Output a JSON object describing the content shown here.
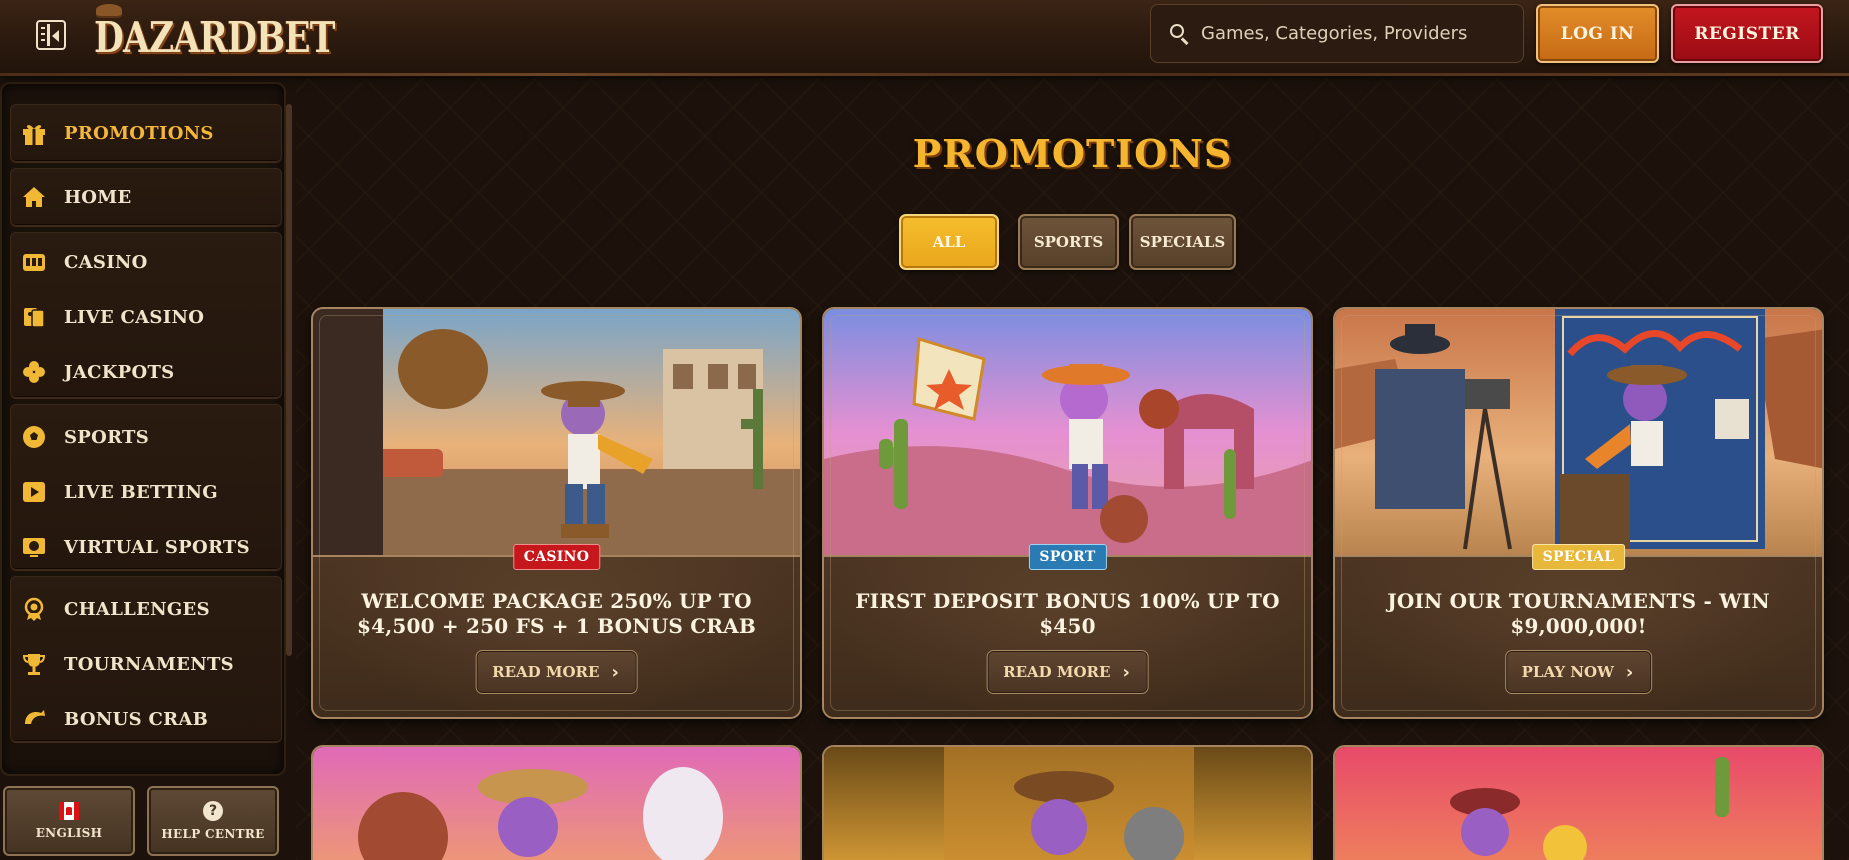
{
  "brand": {
    "logo_text": "DAZARDBET"
  },
  "header": {
    "search_placeholder": "Games, Categories, Providers",
    "login_label": "LOG IN",
    "register_label": "REGISTER"
  },
  "sidebar": {
    "items": [
      {
        "label": "PROMOTIONS",
        "icon": "gift-icon"
      },
      {
        "label": "HOME",
        "icon": "home-icon"
      },
      {
        "label": "CASINO",
        "icon": "slot-machine-icon"
      },
      {
        "label": "LIVE CASINO",
        "icon": "live-cards-icon"
      },
      {
        "label": "JACKPOTS",
        "icon": "clover-icon"
      },
      {
        "label": "SPORTS",
        "icon": "soccer-ball-icon"
      },
      {
        "label": "LIVE BETTING",
        "icon": "play-icon"
      },
      {
        "label": "VIRTUAL SPORTS",
        "icon": "virtual-ball-icon"
      },
      {
        "label": "CHALLENGES",
        "icon": "badge-icon"
      },
      {
        "label": "TOURNAMENTS",
        "icon": "trophy-icon"
      },
      {
        "label": "BONUS CRAB",
        "icon": "crab-icon"
      }
    ],
    "language_label": "ENGLISH",
    "help_label": "HELP CENTRE"
  },
  "main": {
    "title": "PROMOTIONS",
    "filters": [
      "ALL",
      "SPORTS",
      "SPECIALS"
    ],
    "cards": [
      {
        "tag": "CASINO",
        "title": "WELCOME PACKAGE 250% UP TO $4,500 + 250 FS + 1 BONUS CRAB",
        "cta": "READ MORE"
      },
      {
        "tag": "SPORT",
        "title": "FIRST DEPOSIT BONUS 100% UP TO $450",
        "cta": "READ MORE"
      },
      {
        "tag": "SPECIAL",
        "title": "JOIN OUR TOURNAMENTS - WIN $9,000,000!",
        "cta": "PLAY NOW"
      }
    ]
  },
  "colors": {
    "accent": "#f4b73a",
    "login": "#d97d1f",
    "register": "#b3121a",
    "background": "#1c120b"
  }
}
